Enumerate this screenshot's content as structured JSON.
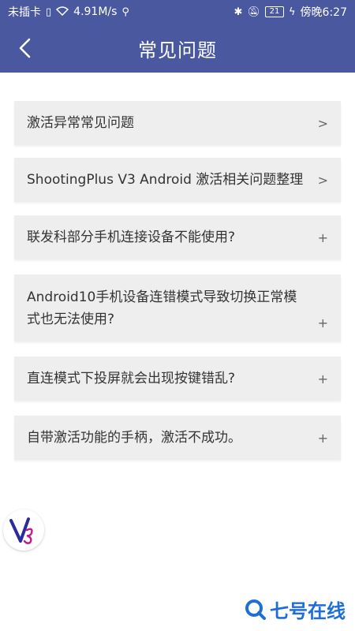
{
  "status_bar": {
    "carrier": "未插卡",
    "speed": "4.91M/s",
    "battery": "21",
    "time": "傍晚6:27"
  },
  "header": {
    "title": "常见问题"
  },
  "faq_items": [
    {
      "label": "激活异常常见问题",
      "sign": ">"
    },
    {
      "label": "ShootingPlus V3 Android 激活相关问题整理",
      "sign": ">"
    },
    {
      "label": "联发科部分手机连接设备不能使用?",
      "sign": "+"
    },
    {
      "label": "Android10手机设备连错模式导致切换正常模式也无法使用?",
      "sign": "+"
    },
    {
      "label": "直连模式下投屏就会出现按键错乱?",
      "sign": "+"
    },
    {
      "label": "自带激活功能的手柄，激活不成功。",
      "sign": "+"
    }
  ],
  "watermark": {
    "text": "七号在线"
  },
  "colors": {
    "header_bg": "#4a58a0",
    "item_bg": "#eeeeee",
    "watermark": "#1f6ed6"
  }
}
